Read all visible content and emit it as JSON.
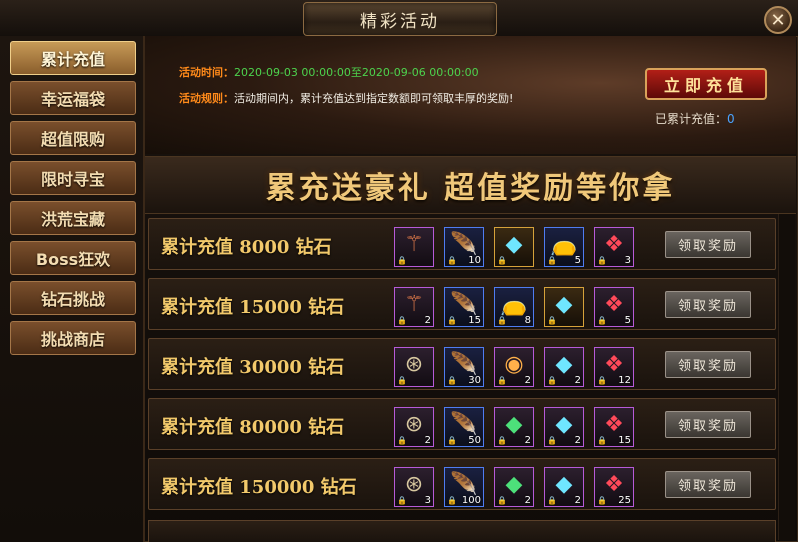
{
  "window": {
    "title": "精彩活动",
    "close_glyph": "✕"
  },
  "sidebar": {
    "items": [
      {
        "label": "累计充值",
        "active": true
      },
      {
        "label": "幸运福袋",
        "active": false
      },
      {
        "label": "超值限购",
        "active": false
      },
      {
        "label": "限时寻宝",
        "active": false
      },
      {
        "label": "洪荒宝藏",
        "active": false
      },
      {
        "label": "Boss狂欢",
        "active": false
      },
      {
        "label": "钻石挑战",
        "active": false
      },
      {
        "label": "挑战商店",
        "active": false
      }
    ]
  },
  "banner": {
    "time_label": "活动时间：",
    "time_value": "2020-09-03 00:00:00至2020-09-06 00:00:00",
    "rule_label": "活动规则：",
    "rule_value": "活动期间内，累计充值达到指定数额即可领取丰厚的奖励!",
    "recharge_button": "立即充值",
    "cumulative_label": "已累计充值：",
    "cumulative_value": "0"
  },
  "slogan": "累充送豪礼  超值奖励等你拿",
  "tiers": [
    {
      "label": "累计充值  8000  钻石",
      "claim": "领取奖励",
      "items": [
        {
          "icon": "scepter-icon",
          "glyph": "⚚",
          "count": "",
          "frame": "purple"
        },
        {
          "icon": "feather-icon",
          "glyph": "🪶",
          "count": "10",
          "frame": "blue"
        },
        {
          "icon": "crystal-icon",
          "glyph": "◆",
          "count": "",
          "frame": "gold"
        },
        {
          "icon": "pouch-icon",
          "glyph": "👝",
          "count": "5",
          "frame": "blue"
        },
        {
          "icon": "red-gem-icon",
          "glyph": "❖",
          "count": "3",
          "frame": "purple"
        }
      ]
    },
    {
      "label": "累计充值  15000 钻石",
      "claim": "领取奖励",
      "items": [
        {
          "icon": "scepter-icon",
          "glyph": "⚚",
          "count": "2",
          "frame": "purple"
        },
        {
          "icon": "feather-icon",
          "glyph": "🪶",
          "count": "15",
          "frame": "blue"
        },
        {
          "icon": "pouch-icon",
          "glyph": "👝",
          "count": "8",
          "frame": "blue"
        },
        {
          "icon": "crystal-icon",
          "glyph": "◆",
          "count": "",
          "frame": "gold"
        },
        {
          "icon": "red-gem-icon",
          "glyph": "❖",
          "count": "5",
          "frame": "purple"
        }
      ]
    },
    {
      "label": "累计充值  30000 钻石",
      "claim": "领取奖励",
      "items": [
        {
          "icon": "compass-icon",
          "glyph": "⊛",
          "count": "",
          "frame": "purple"
        },
        {
          "icon": "feather-icon",
          "glyph": "🪶",
          "count": "30",
          "frame": "blue"
        },
        {
          "icon": "orb-icon",
          "glyph": "◉",
          "count": "2",
          "frame": "purple"
        },
        {
          "icon": "crystal-icon",
          "glyph": "◆",
          "count": "2",
          "frame": "purple"
        },
        {
          "icon": "red-gem-icon",
          "glyph": "❖",
          "count": "12",
          "frame": "purple"
        }
      ]
    },
    {
      "label": "累计充值  80000 钻石",
      "claim": "领取奖励",
      "items": [
        {
          "icon": "compass-icon",
          "glyph": "⊛",
          "count": "2",
          "frame": "purple"
        },
        {
          "icon": "feather-icon",
          "glyph": "🪶",
          "count": "50",
          "frame": "blue"
        },
        {
          "icon": "green-crystal-icon",
          "glyph": "◆",
          "count": "2",
          "frame": "purple"
        },
        {
          "icon": "crystal-icon",
          "glyph": "◆",
          "count": "2",
          "frame": "purple"
        },
        {
          "icon": "red-gem-icon",
          "glyph": "❖",
          "count": "15",
          "frame": "purple"
        }
      ]
    },
    {
      "label": "累计充值 150000 钻石",
      "claim": "领取奖励",
      "items": [
        {
          "icon": "compass-icon",
          "glyph": "⊛",
          "count": "3",
          "frame": "purple"
        },
        {
          "icon": "feather-icon",
          "glyph": "🪶",
          "count": "100",
          "frame": "blue"
        },
        {
          "icon": "green-crystal-icon",
          "glyph": "◆",
          "count": "2",
          "frame": "purple"
        },
        {
          "icon": "crystal-icon",
          "glyph": "◆",
          "count": "2",
          "frame": "purple"
        },
        {
          "icon": "red-gem-icon",
          "glyph": "❖",
          "count": "25",
          "frame": "purple"
        }
      ]
    }
  ],
  "colors": {
    "accent_orange": "#ff8a1a",
    "time_green": "#4dd34d",
    "gold_text": "#f2c96b",
    "recharge_red": "#b21f17"
  }
}
